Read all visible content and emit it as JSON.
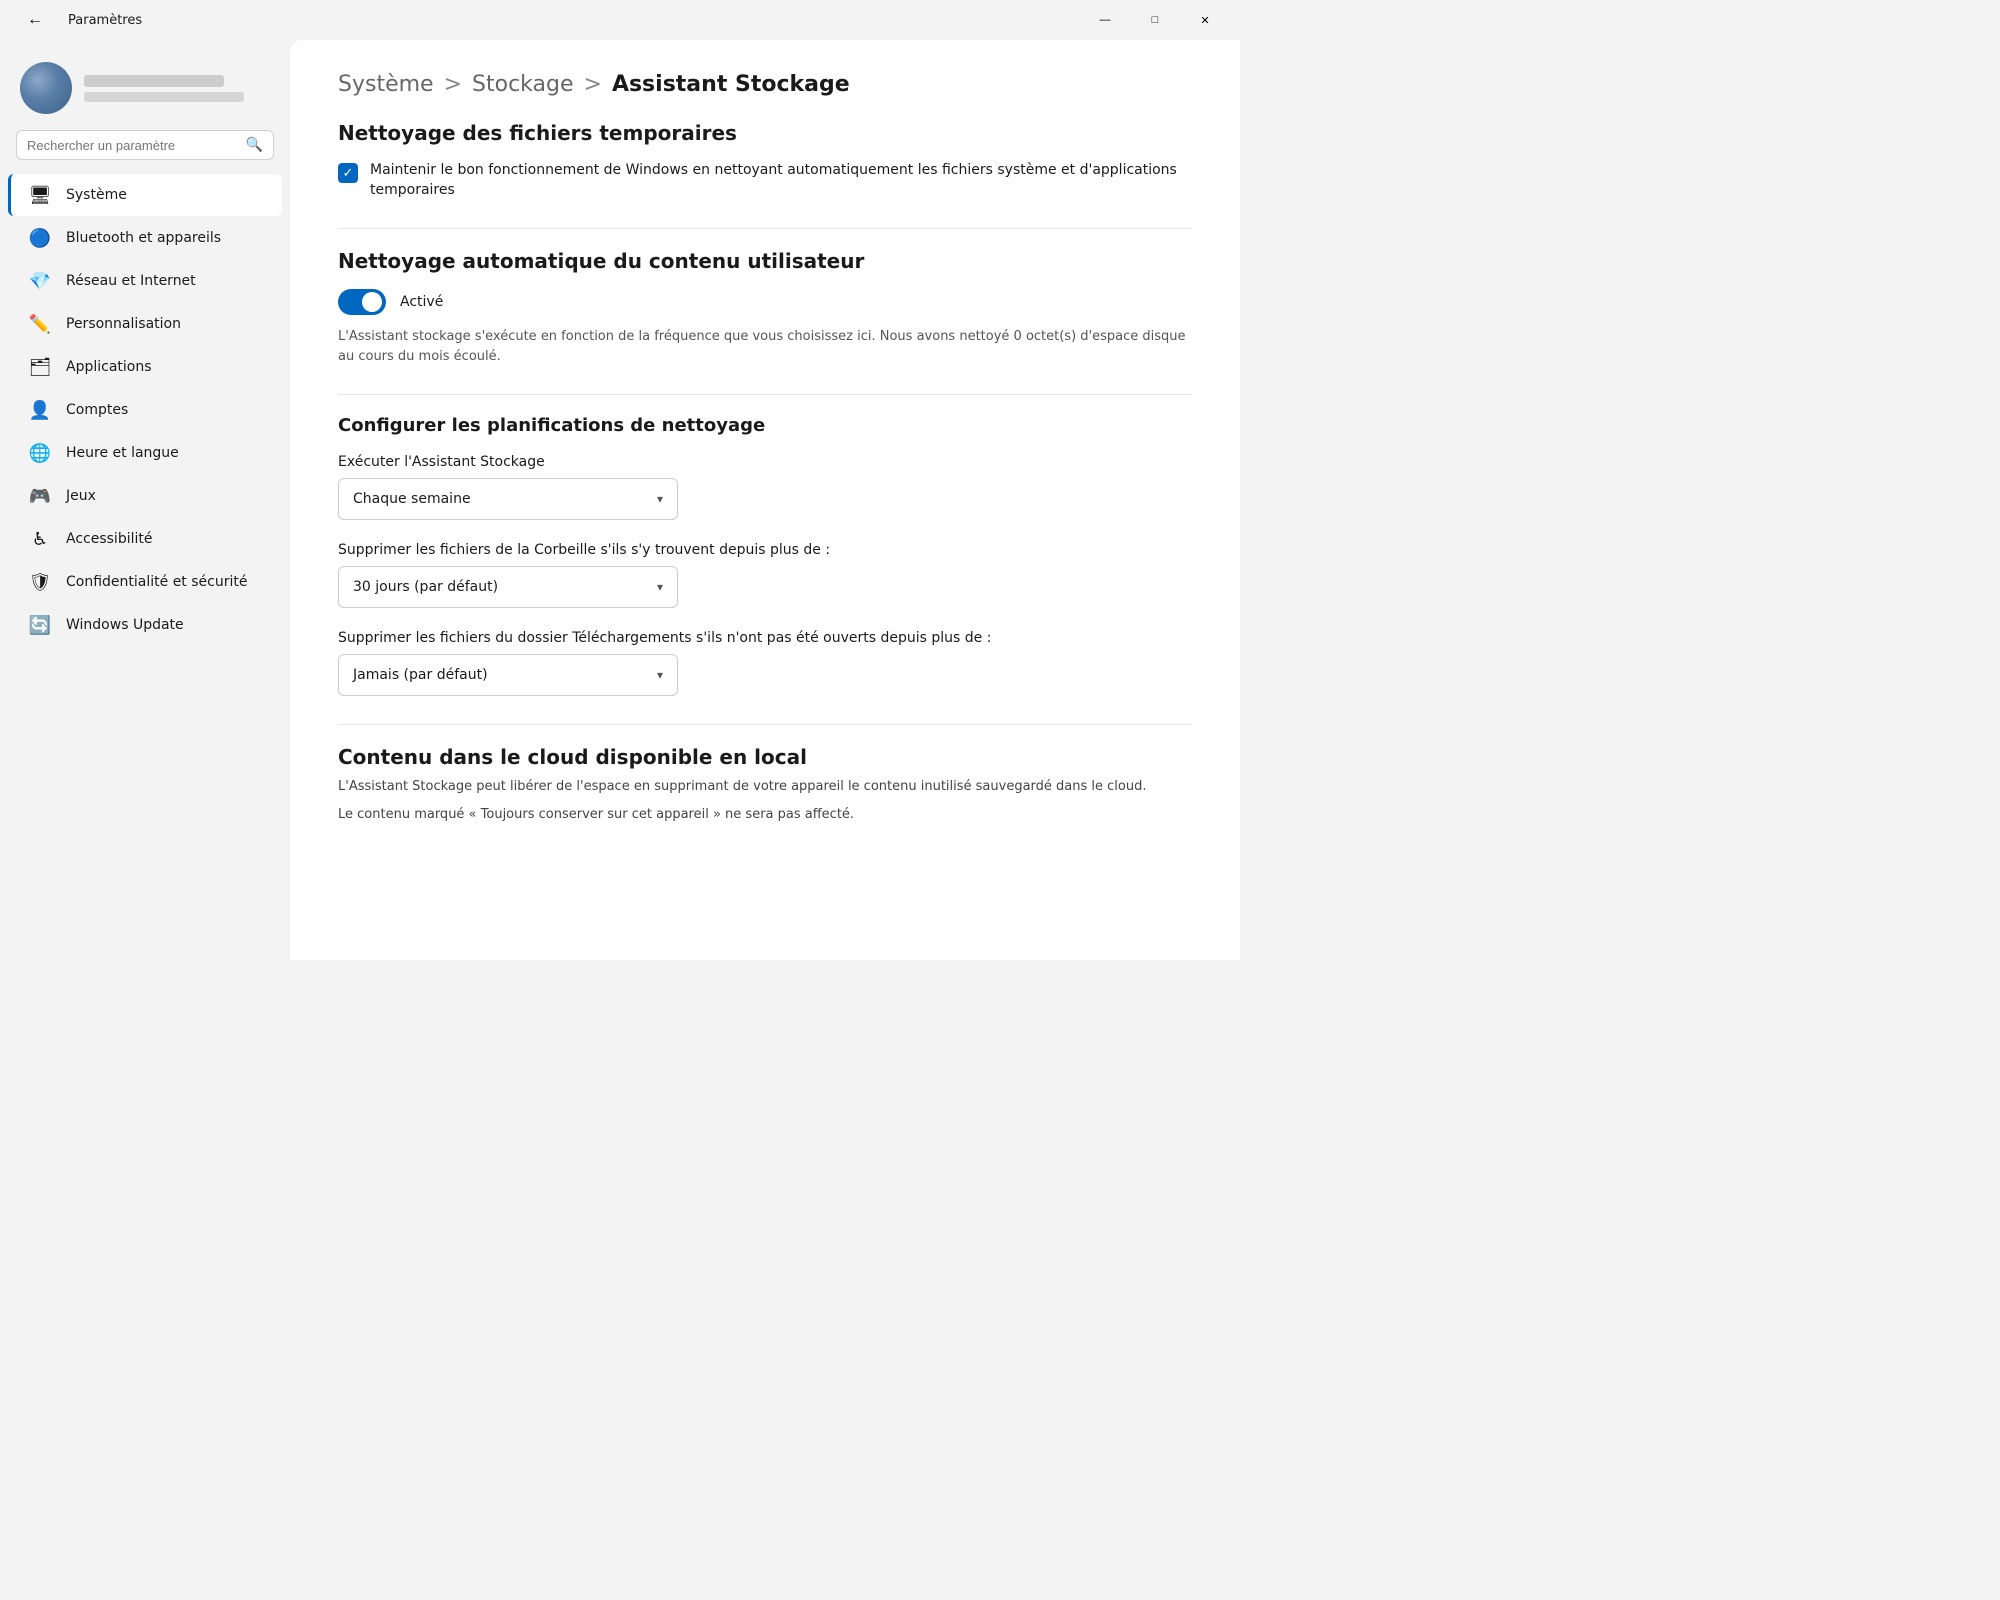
{
  "window": {
    "title": "Paramètres",
    "controls": {
      "minimize": "—",
      "maximize": "□",
      "close": "✕"
    }
  },
  "user": {
    "name_placeholder": "",
    "email_placeholder": ""
  },
  "search": {
    "placeholder": "Rechercher un paramètre"
  },
  "sidebar": {
    "items": [
      {
        "id": "systeme",
        "label": "Système",
        "icon": "🖥",
        "active": true
      },
      {
        "id": "bluetooth",
        "label": "Bluetooth et appareils",
        "icon": "🔵"
      },
      {
        "id": "reseau",
        "label": "Réseau et Internet",
        "icon": "💎"
      },
      {
        "id": "personnalisation",
        "label": "Personnalisation",
        "icon": "🖊"
      },
      {
        "id": "applications",
        "label": "Applications",
        "icon": "🗂"
      },
      {
        "id": "comptes",
        "label": "Comptes",
        "icon": "👤"
      },
      {
        "id": "heure",
        "label": "Heure et langue",
        "icon": "🌐"
      },
      {
        "id": "jeux",
        "label": "Jeux",
        "icon": "🎮"
      },
      {
        "id": "accessibilite",
        "label": "Accessibilité",
        "icon": "♿"
      },
      {
        "id": "confidentialite",
        "label": "Confidentialité et sécurité",
        "icon": "🛡"
      },
      {
        "id": "windows-update",
        "label": "Windows Update",
        "icon": "🔄"
      }
    ]
  },
  "breadcrumb": {
    "part1": "Système",
    "sep1": ">",
    "part2": "Stockage",
    "sep2": ">",
    "part3": "Assistant Stockage"
  },
  "sections": {
    "temp_files": {
      "title": "Nettoyage des fichiers temporaires",
      "checkbox_label": "Maintenir le bon fonctionnement de Windows en nettoyant automatiquement les fichiers système et d'applications temporaires"
    },
    "auto_cleanup": {
      "title": "Nettoyage automatique du contenu utilisateur",
      "toggle_label": "Activé",
      "description": "L'Assistant stockage s'exécute en fonction de la fréquence que vous choisissez ici. Nous avons nettoyé 0 octet(s) d'espace disque au cours du mois écoulé."
    },
    "planning": {
      "title": "Configurer les planifications de nettoyage",
      "run_label": "Exécuter l'Assistant Stockage",
      "run_value": "Chaque semaine",
      "corbeille_label": "Supprimer les fichiers de la Corbeille s'ils s'y trouvent depuis plus de :",
      "corbeille_value": "30 jours (par défaut)",
      "telechargements_label": "Supprimer les fichiers du dossier Téléchargements s'ils n'ont pas été ouverts depuis plus de :",
      "telechargements_value": "Jamais (par défaut)"
    },
    "cloud": {
      "title": "Contenu dans le cloud disponible en local",
      "desc1": "L'Assistant Stockage peut libérer de l'espace en supprimant de votre appareil le contenu inutilisé sauvegardé dans le cloud.",
      "desc2": "Le contenu marqué « Toujours conserver sur cet appareil » ne sera pas affecté."
    }
  }
}
